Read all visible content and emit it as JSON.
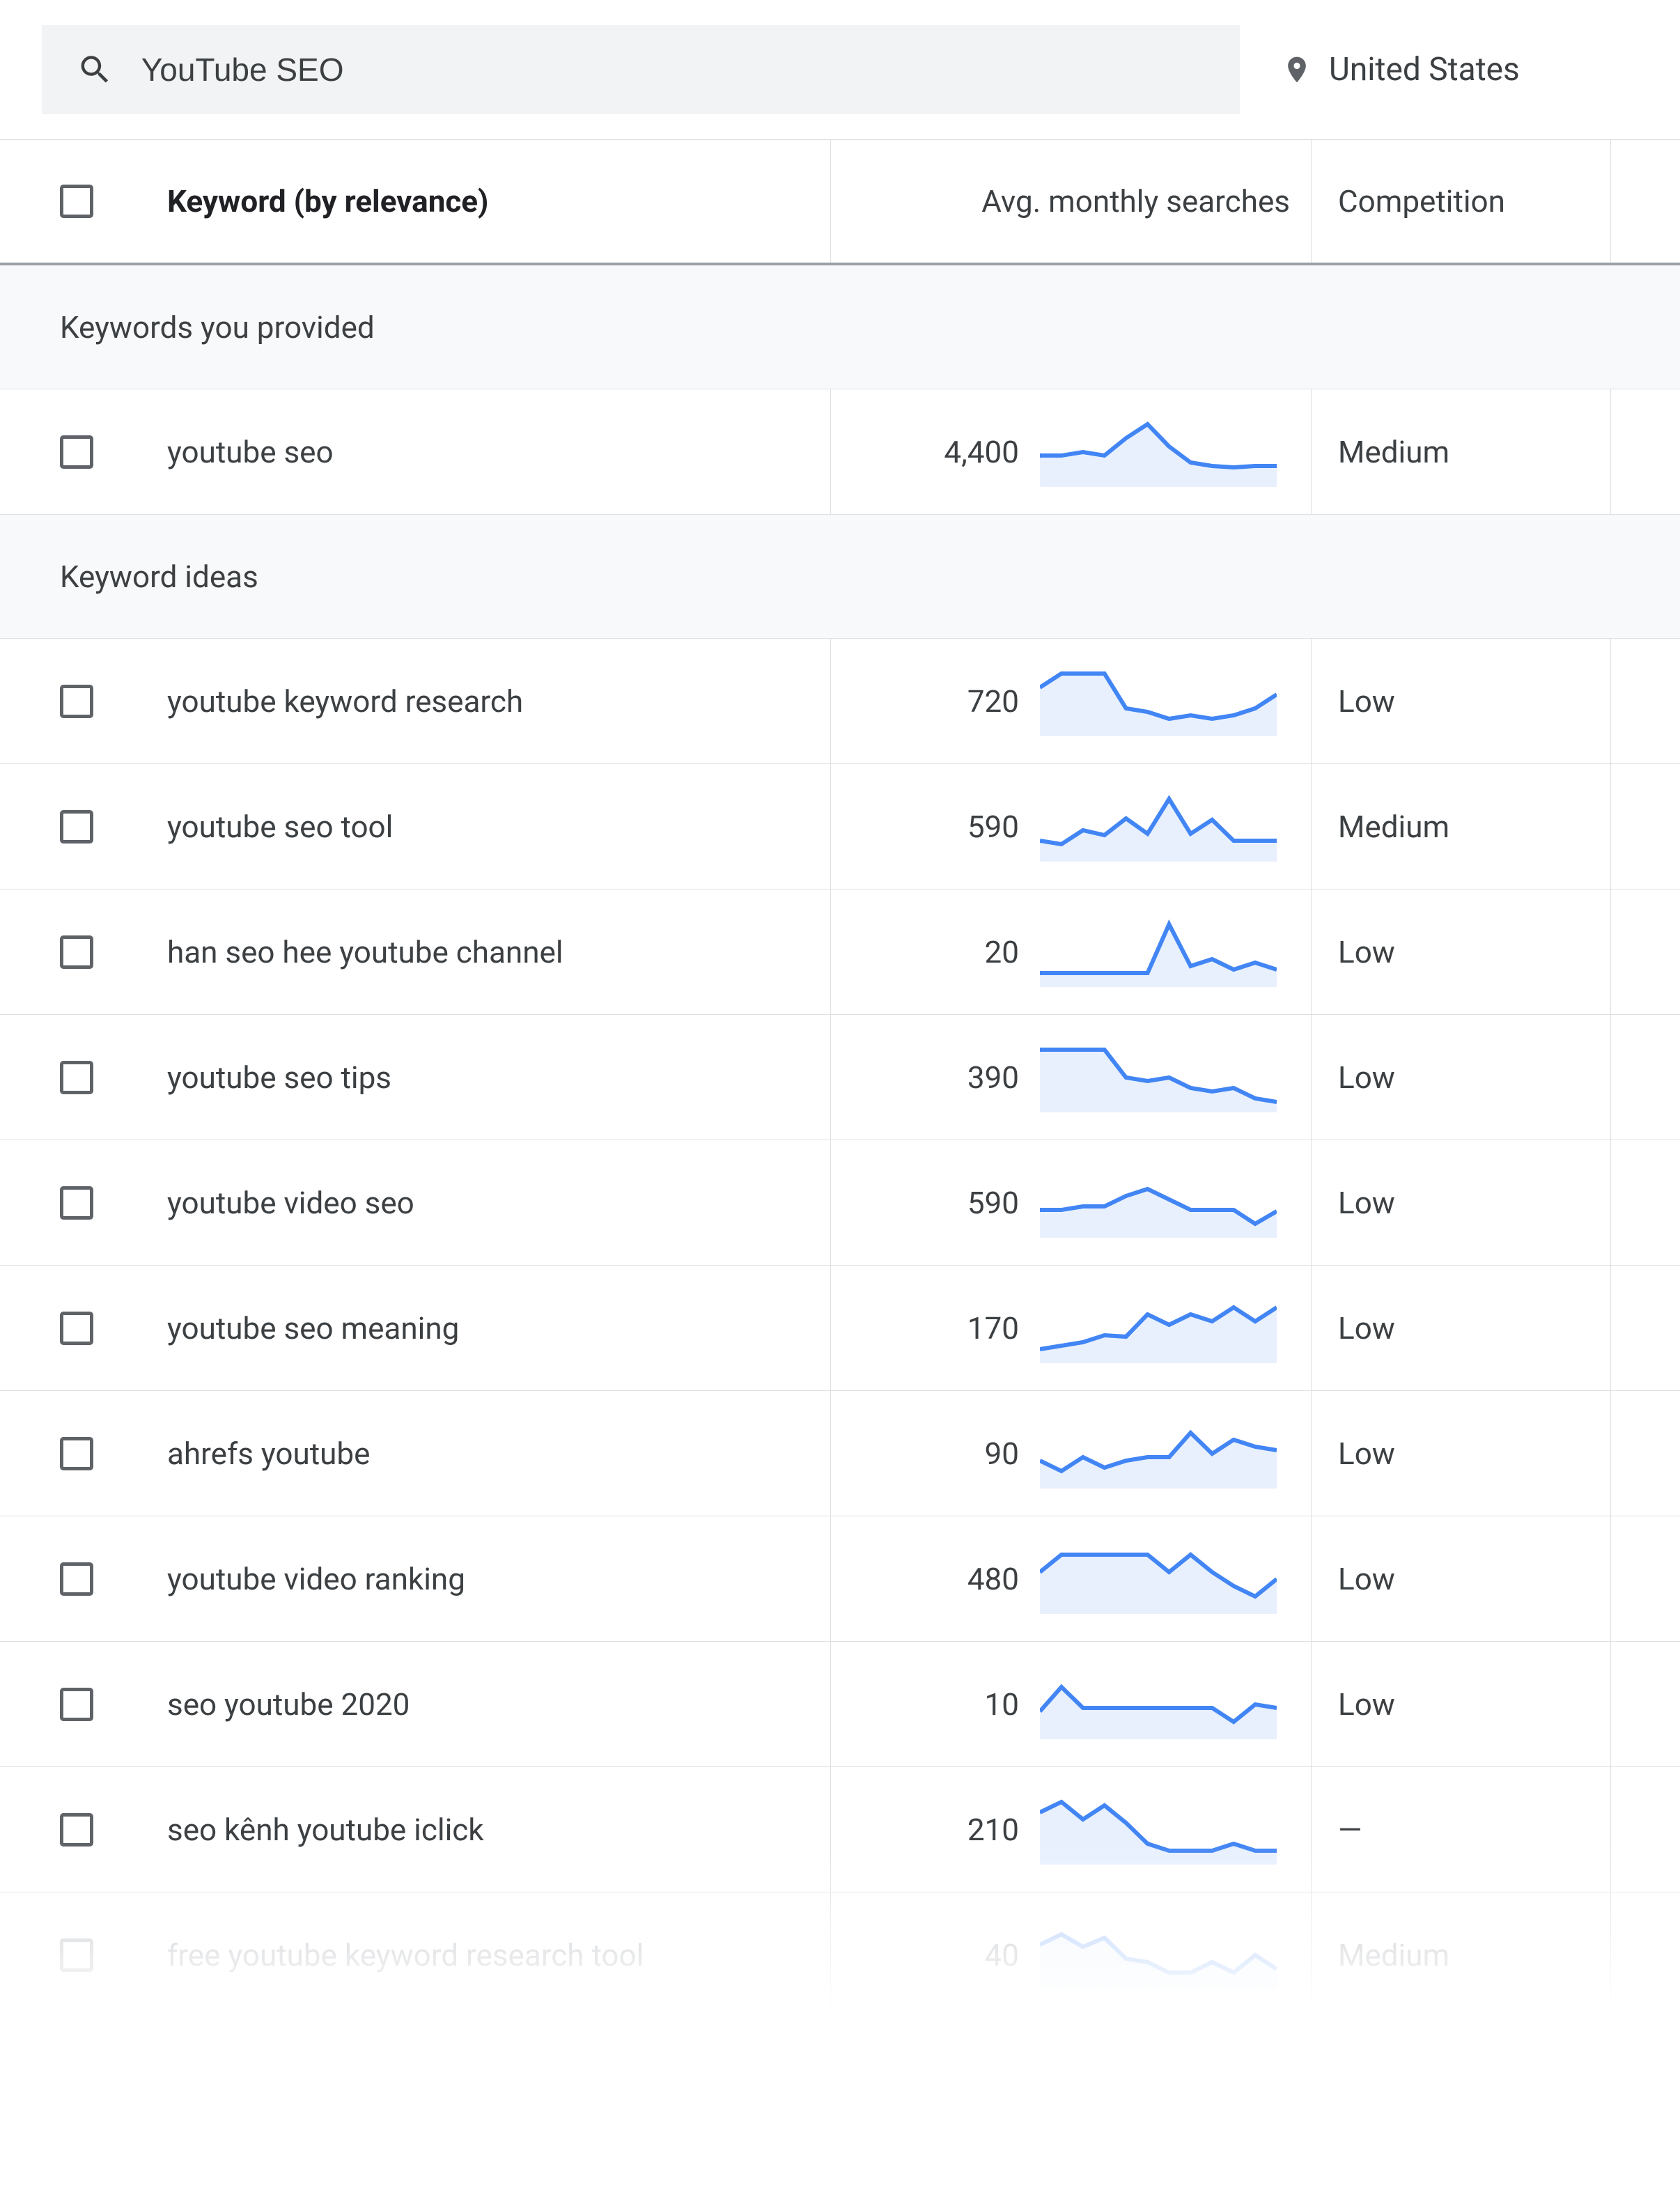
{
  "search": {
    "value": "YouTube SEO"
  },
  "location": "United States",
  "headers": {
    "keyword": "Keyword (by relevance)",
    "searches": "Avg. monthly searches",
    "competition": "Competition"
  },
  "sections": {
    "provided": "Keywords you provided",
    "ideas": "Keyword ideas"
  },
  "provided": [
    {
      "keyword": "youtube seo",
      "searches": "4,400",
      "competition": "Medium",
      "spark": [
        55,
        55,
        50,
        55,
        30,
        10,
        42,
        65,
        70,
        72,
        70,
        70
      ]
    }
  ],
  "ideas": [
    {
      "keyword": "youtube keyword research",
      "searches": "720",
      "competition": "Low",
      "spark": [
        30,
        10,
        10,
        10,
        60,
        65,
        75,
        70,
        75,
        70,
        60,
        40
      ]
    },
    {
      "keyword": "youtube seo tool",
      "searches": "590",
      "competition": "Medium",
      "spark": [
        70,
        75,
        55,
        62,
        38,
        60,
        10,
        60,
        40,
        70,
        70,
        70
      ]
    },
    {
      "keyword": "han seo hee youtube channel",
      "searches": "20",
      "competition": "Low",
      "spark": [
        80,
        80,
        80,
        80,
        80,
        80,
        10,
        70,
        60,
        75,
        65,
        75
      ]
    },
    {
      "keyword": "youtube seo tips",
      "searches": "390",
      "competition": "Low",
      "spark": [
        10,
        10,
        10,
        10,
        50,
        55,
        50,
        65,
        70,
        65,
        80,
        85
      ]
    },
    {
      "keyword": "youtube video seo",
      "searches": "590",
      "competition": "Low",
      "spark": [
        60,
        60,
        55,
        55,
        40,
        30,
        45,
        60,
        60,
        60,
        80,
        62
      ]
    },
    {
      "keyword": "youtube seo meaning",
      "searches": "170",
      "competition": "Low",
      "spark": [
        80,
        75,
        70,
        60,
        62,
        30,
        45,
        30,
        40,
        20,
        40,
        20
      ]
    },
    {
      "keyword": "ahrefs youtube",
      "searches": "90",
      "competition": "Low",
      "spark": [
        60,
        75,
        55,
        70,
        60,
        55,
        55,
        20,
        50,
        30,
        40,
        45
      ]
    },
    {
      "keyword": "youtube video ranking",
      "searches": "480",
      "competition": "Low",
      "spark": [
        40,
        15,
        15,
        15,
        15,
        15,
        40,
        15,
        40,
        60,
        75,
        50
      ]
    },
    {
      "keyword": "seo youtube 2020",
      "searches": "10",
      "competition": "Low",
      "spark": [
        60,
        25,
        55,
        55,
        55,
        55,
        55,
        55,
        55,
        75,
        50,
        55
      ]
    },
    {
      "keyword": "seo kênh youtube iclick",
      "searches": "210",
      "competition": "—",
      "spark": [
        25,
        10,
        35,
        15,
        40,
        70,
        80,
        80,
        80,
        70,
        80,
        80
      ]
    },
    {
      "keyword": "free youtube keyword research tool",
      "searches": "40",
      "competition": "Medium",
      "spark": [
        35,
        20,
        38,
        25,
        55,
        60,
        75,
        75,
        60,
        75,
        50,
        70
      ],
      "faded": true
    }
  ]
}
